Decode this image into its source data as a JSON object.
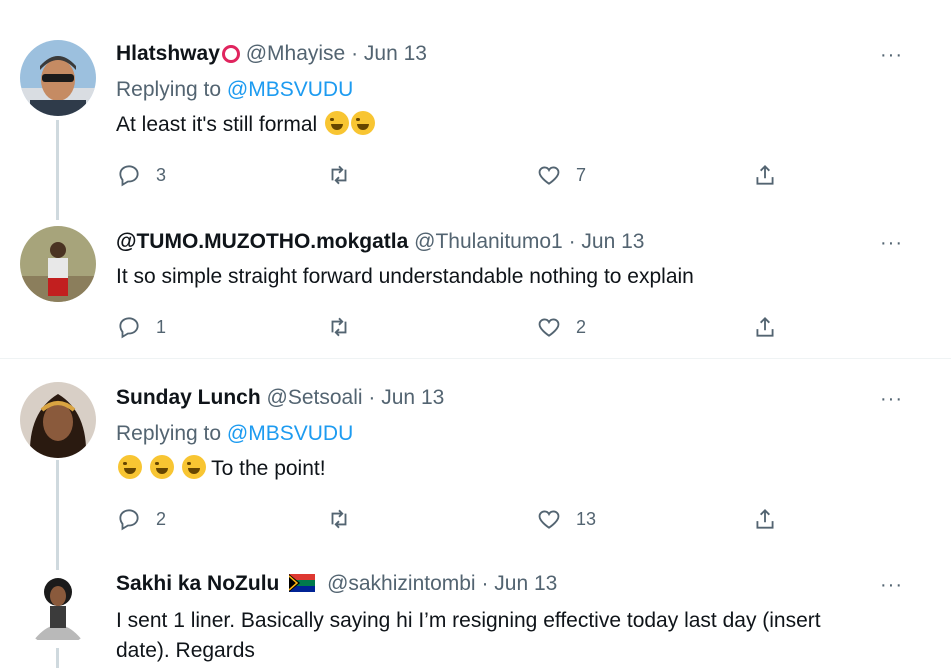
{
  "more_label": "···",
  "tweets": [
    {
      "name": "Hlatshway",
      "handle": "@Mhayise",
      "dot": "·",
      "date": "Jun 13",
      "replying_prefix": "Replying to",
      "replying_to": "@MBSVUDU",
      "text": "At least it's still formal",
      "replies": "3",
      "retweets": "",
      "likes": "7"
    },
    {
      "name": "@TUMO.MUZOTHO.mokgatla",
      "handle": "@Thulanitumo1",
      "dot": "·",
      "date": "Jun 13",
      "text": "It so simple straight forward understandable nothing to explain",
      "replies": "1",
      "retweets": "",
      "likes": "2"
    },
    {
      "name": "Sunday Lunch",
      "handle": "@Setsoali",
      "dot": "·",
      "date": "Jun 13",
      "replying_prefix": "Replying to",
      "replying_to": "@MBSVUDU",
      "text": "To the point!",
      "replies": "2",
      "retweets": "",
      "likes": "13"
    },
    {
      "name": "Sakhi ka NoZulu",
      "handle": "@sakhizintombi",
      "dot": "·",
      "date": "Jun 13",
      "text_line1": "I sent 1 liner. Basically saying hi I’m resigning effective today last day (insert",
      "text_line2": "date). Regards"
    }
  ],
  "colors": {
    "accent": "#1d9bf0",
    "muted": "#536471",
    "text": "#0f1419",
    "thread_line": "#cfd9de"
  }
}
